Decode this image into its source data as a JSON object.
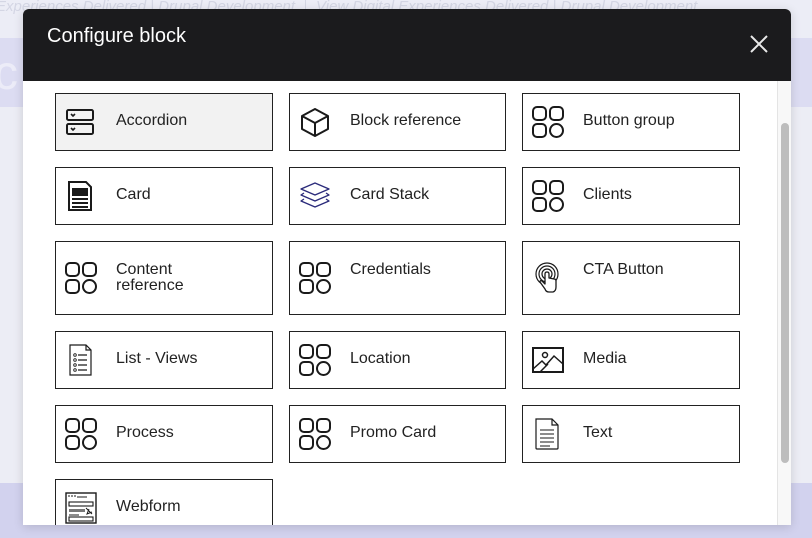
{
  "background": {
    "breadcrumb_left": "Experiences Delivered | Drupal Development",
    "breadcrumb_right": "View Digital Experiences Delivered | Drupal Development",
    "band_text": "c b"
  },
  "dialog": {
    "title": "Configure block",
    "close_label": "Close"
  },
  "blocks": [
    {
      "label": "Accordion",
      "icon": "accordion-icon",
      "active": true
    },
    {
      "label": "Block reference",
      "icon": "cube-icon"
    },
    {
      "label": "Button group",
      "icon": "grid-shapes-icon"
    },
    {
      "label": "Card",
      "icon": "card-document-icon"
    },
    {
      "label": "Card Stack",
      "icon": "layers-icon"
    },
    {
      "label": "Clients",
      "icon": "grid-shapes-icon"
    },
    {
      "label": "Content reference",
      "icon": "grid-shapes-icon"
    },
    {
      "label": "Credentials",
      "icon": "grid-shapes-icon"
    },
    {
      "label": "CTA Button",
      "icon": "touch-tap-icon"
    },
    {
      "label": "List - Views",
      "icon": "list-document-icon"
    },
    {
      "label": "Location",
      "icon": "grid-shapes-icon"
    },
    {
      "label": "Media",
      "icon": "image-icon"
    },
    {
      "label": "Process",
      "icon": "grid-shapes-icon"
    },
    {
      "label": "Promo Card",
      "icon": "grid-shapes-icon"
    },
    {
      "label": "Text",
      "icon": "text-document-icon"
    },
    {
      "label": "Webform",
      "icon": "webform-icon"
    }
  ],
  "colors": {
    "header_bg": "#1b1b1d",
    "tile_border": "#222222",
    "active_tile_bg": "#f2f2f2",
    "layers_icon": "#2a2a7a"
  }
}
